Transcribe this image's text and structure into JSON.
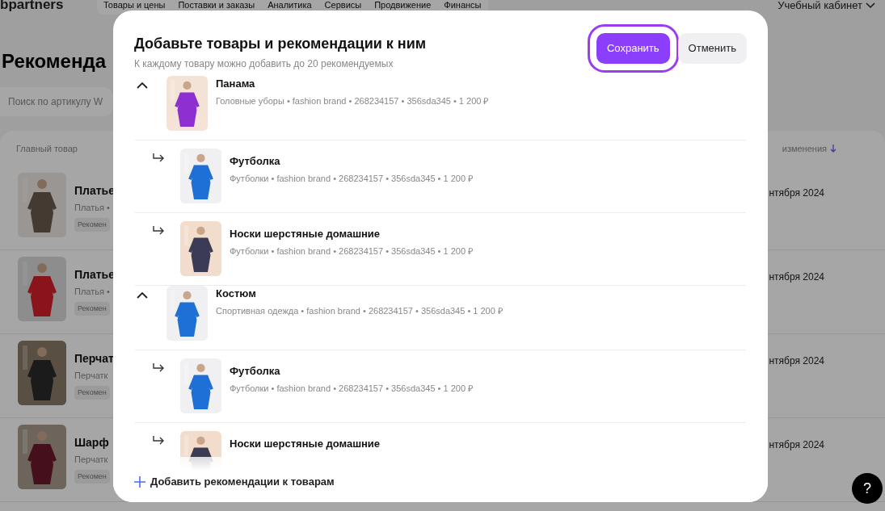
{
  "header": {
    "logo": "bpartners",
    "nav": [
      "Товары и цены",
      "Поставки и заказы",
      "Аналитика",
      "Сервисы",
      "Продвижение",
      "Финансы"
    ],
    "account": "Учебный кабинет"
  },
  "page": {
    "title": "Рекоменда",
    "search": {
      "placeholder": "Поиск по артикулу W"
    },
    "table": {
      "columns": [
        "Главный товар",
        "изменения"
      ],
      "rows": [
        {
          "name": "Платье",
          "category": "Платья •",
          "tag": "Рекомен",
          "date": "нтября 2024"
        },
        {
          "name": "Платье",
          "category": "Платья •",
          "tag": "Рекомен",
          "date": "нтября 2024"
        },
        {
          "name": "Перчат",
          "category": "Перчатк",
          "tag": "Рекомен",
          "date": "нтября 2024"
        },
        {
          "name": "Шарф",
          "category": "Перчатк",
          "tag": "Рекомен",
          "date": "нтября 2024"
        }
      ]
    }
  },
  "modal": {
    "title": "Добавьте товары и рекомендации к ним",
    "subtitle": "К каждому товару можно добавить до 20 рекомендуемых",
    "buttons": [
      {
        "label": "Сохранить",
        "kind": "primary",
        "focused": true
      },
      {
        "label": "Отменить",
        "kind": "secondary",
        "focused": false
      }
    ],
    "groups": [
      {
        "name": "Панама",
        "meta": "Головные уборы • fashion brand • 268234157 • 356sda345 • 1 200 ₽",
        "expanded": true,
        "children": [
          {
            "name": "Футболка",
            "meta": "Футболки • fashion brand • 268234157 • 356sda345 • 1 200 ₽"
          },
          {
            "name": "Носки шерстяные домашние",
            "meta": "Футболки • fashion brand • 268234157 • 356sda345 • 1 200 ₽"
          }
        ]
      },
      {
        "name": "Костюм",
        "meta": "Спортивная одежда • fashion brand • 268234157 • 356sda345 • 1 200 ₽",
        "expanded": true,
        "children": [
          {
            "name": "Футболка",
            "meta": "Футболки • fashion brand • 268234157 • 356sda345 • 1 200 ₽"
          },
          {
            "name": "Носки шерстяные домашние"
          }
        ]
      }
    ],
    "add_button": "Добавить рекомендации к товарам"
  },
  "help_button": "?"
}
